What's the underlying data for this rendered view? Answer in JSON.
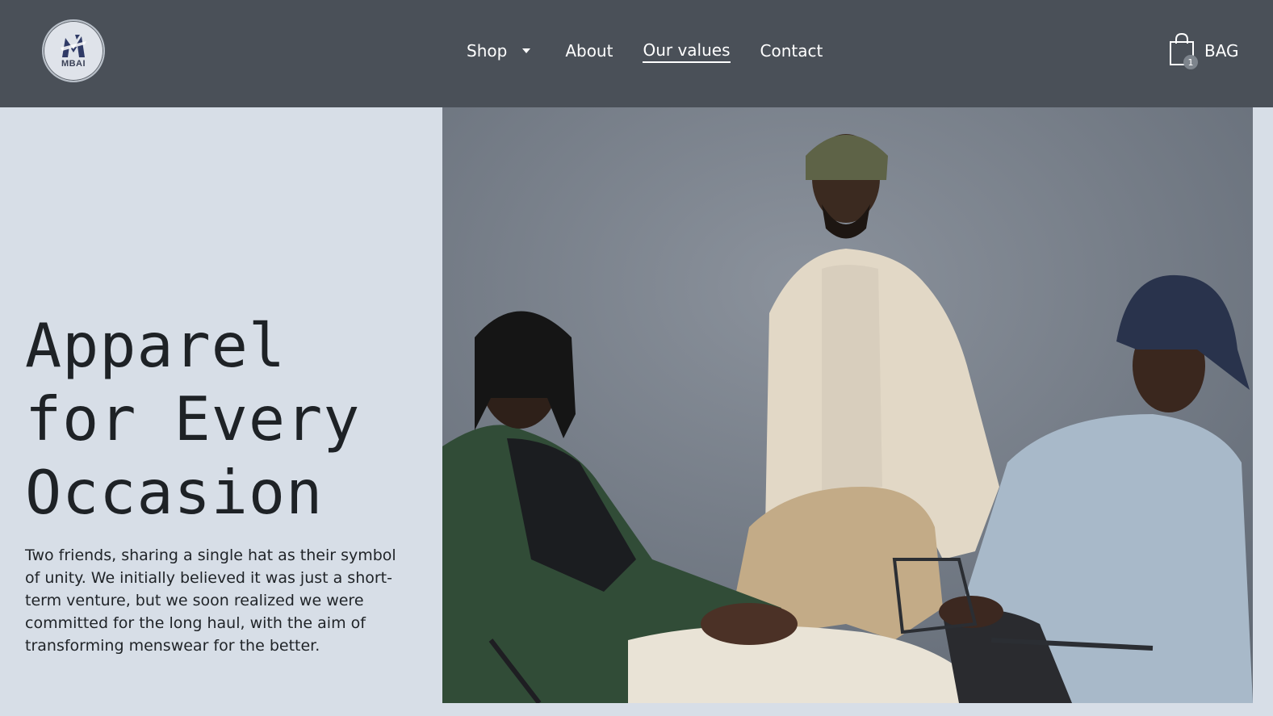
{
  "header": {
    "logo_text": "MBAI",
    "nav": {
      "shop": "Shop",
      "about": "About",
      "values": "Our values",
      "contact": "Contact"
    },
    "bag": {
      "label": "BAG",
      "count": "1"
    }
  },
  "hero": {
    "title_line1": "Apparel",
    "title_line2": "for Every",
    "title_line3": "Occasion",
    "description": "Two friends, sharing a single hat as their symbol of unity. We initially believed it was just a short-term venture, but we soon realized we were committed for the long haul, with the aim of transforming menswear for the better."
  },
  "icons": {
    "shop_dropdown": "caret-down-icon",
    "bag": "shopping-bag-icon"
  },
  "colors": {
    "header_bg": "#4a5058",
    "page_bg": "#d7dee7",
    "title_text": "#1e2226",
    "nav_text": "#ffffff"
  }
}
